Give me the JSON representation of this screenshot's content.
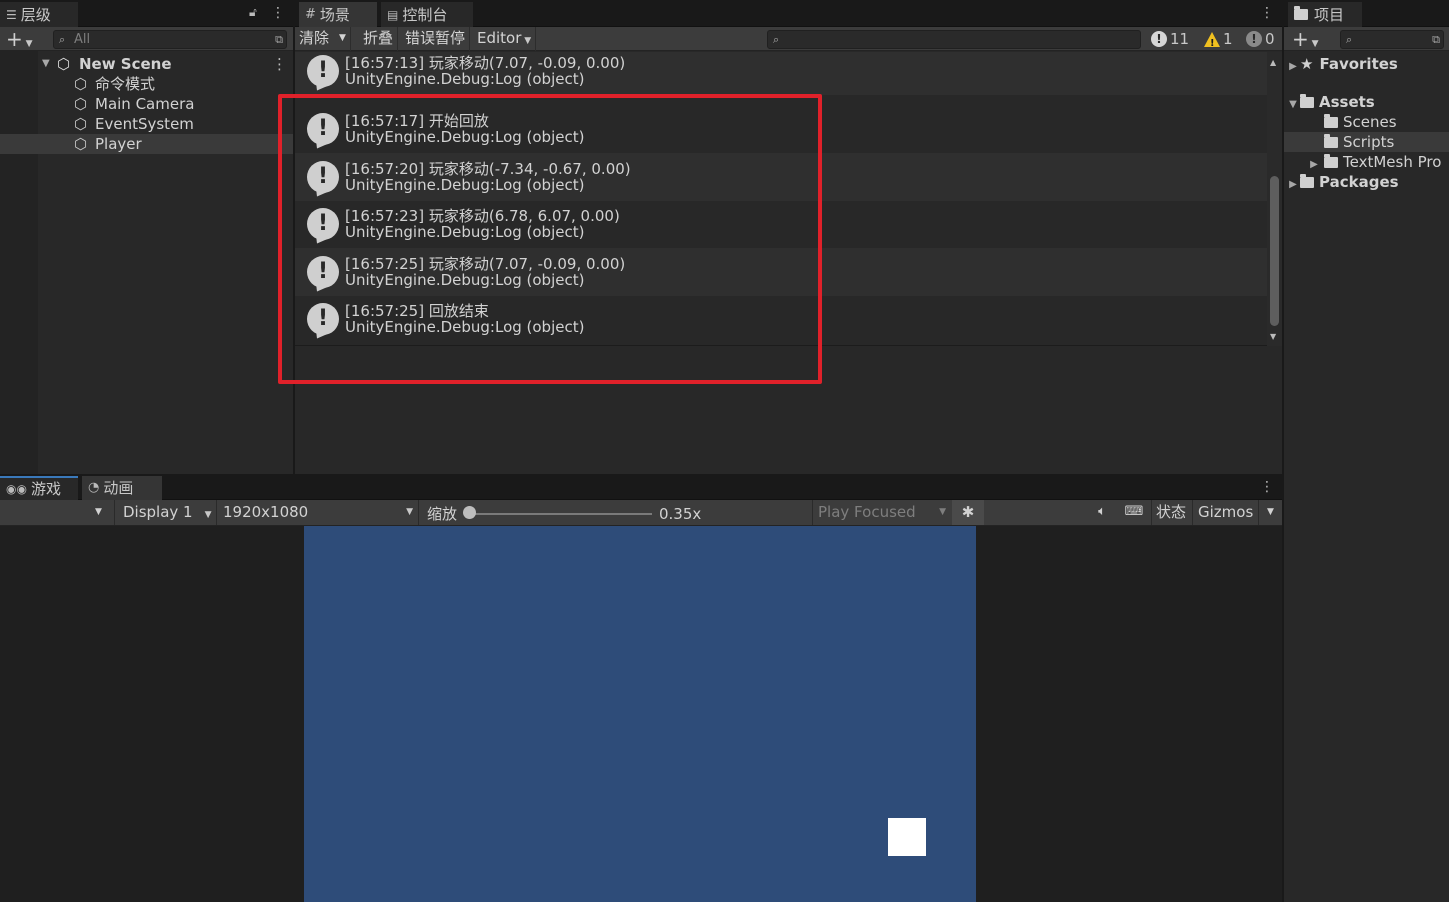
{
  "hierarchy": {
    "tab_label": "层级",
    "search_placeholder": "All",
    "scene_name": "New Scene",
    "items": [
      "命令模式",
      "Main Camera",
      "EventSystem",
      "Player"
    ]
  },
  "center_tabs": {
    "scene": "场景",
    "console": "控制台"
  },
  "console": {
    "buttons": {
      "clear": "清除",
      "collapse": "折叠",
      "error_pause": "错误暂停",
      "editor": "Editor"
    },
    "counts": {
      "info": "11",
      "warning": "1",
      "error": "0"
    },
    "logs": [
      {
        "line1": "[16:57:13] 玩家移动(7.07, -0.09, 0.00)",
        "line2": "UnityEngine.Debug:Log (object)"
      },
      {
        "line1": "[16:57:17] 开始回放",
        "line2": "UnityEngine.Debug:Log (object)"
      },
      {
        "line1": "[16:57:20] 玩家移动(-7.34, -0.67, 0.00)",
        "line2": "UnityEngine.Debug:Log (object)"
      },
      {
        "line1": "[16:57:23] 玩家移动(6.78, 6.07, 0.00)",
        "line2": "UnityEngine.Debug:Log (object)"
      },
      {
        "line1": "[16:57:25] 玩家移动(7.07, -0.09, 0.00)",
        "line2": "UnityEngine.Debug:Log (object)"
      },
      {
        "line1": "[16:57:25] 回放结束",
        "line2": "UnityEngine.Debug:Log (object)"
      }
    ]
  },
  "project": {
    "tab_label": "项目",
    "favorites": "Favorites",
    "assets": "Assets",
    "folders": [
      "Scenes",
      "Scripts",
      "TextMesh Pro"
    ],
    "packages": "Packages"
  },
  "game": {
    "tabs": {
      "game": "游戏",
      "animation": "动画"
    },
    "display": "Display 1",
    "resolution": "1920x1080",
    "scale_label": "缩放",
    "scale_value": "0.35x",
    "play_mode": "Play Focused",
    "stats": "状态",
    "gizmos": "Gizmos"
  },
  "colors": {
    "highlight": "#e0212a",
    "viewport_bg": "#2e4c79",
    "player": "#ffffff"
  }
}
